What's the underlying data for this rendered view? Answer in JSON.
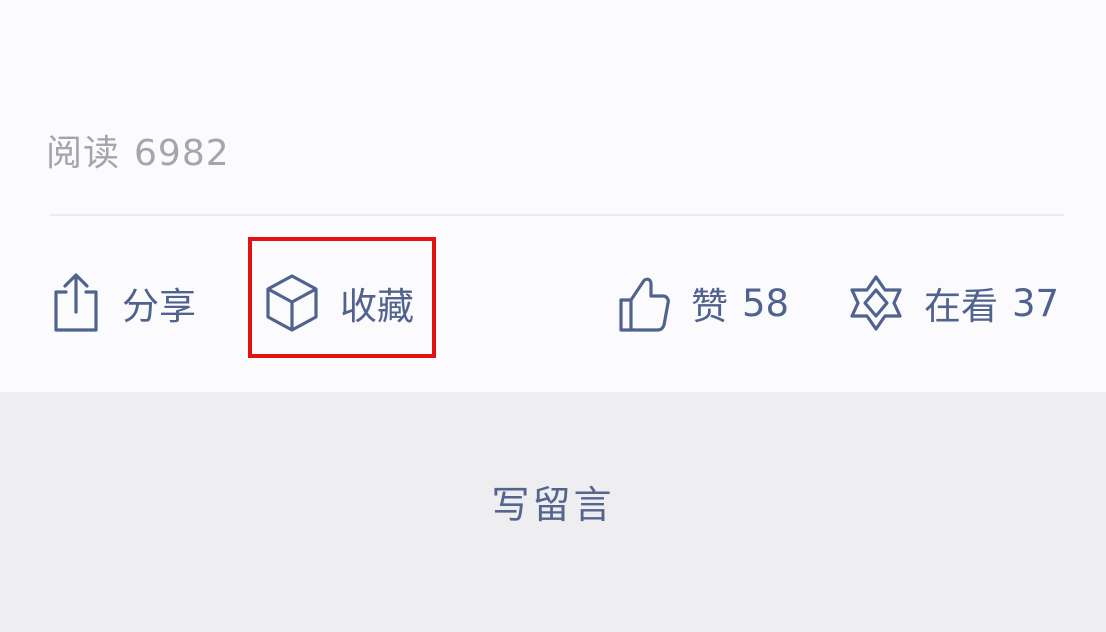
{
  "stats": {
    "read_label": "阅读",
    "read_count": "6982"
  },
  "actions": {
    "share": {
      "label": "分享",
      "icon": "share-icon"
    },
    "collect": {
      "label": "收藏",
      "icon": "cube-icon"
    },
    "like": {
      "label": "赞",
      "count": "58",
      "icon": "thumbs-up-icon"
    },
    "watching": {
      "label": "在看",
      "count": "37",
      "icon": "watching-star-icon"
    }
  },
  "comment": {
    "label": "写留言"
  },
  "colors": {
    "accent": "#50628e",
    "muted_text": "#a6a6a9",
    "highlight": "#e01212",
    "footer_bg": "#eeeef1"
  }
}
